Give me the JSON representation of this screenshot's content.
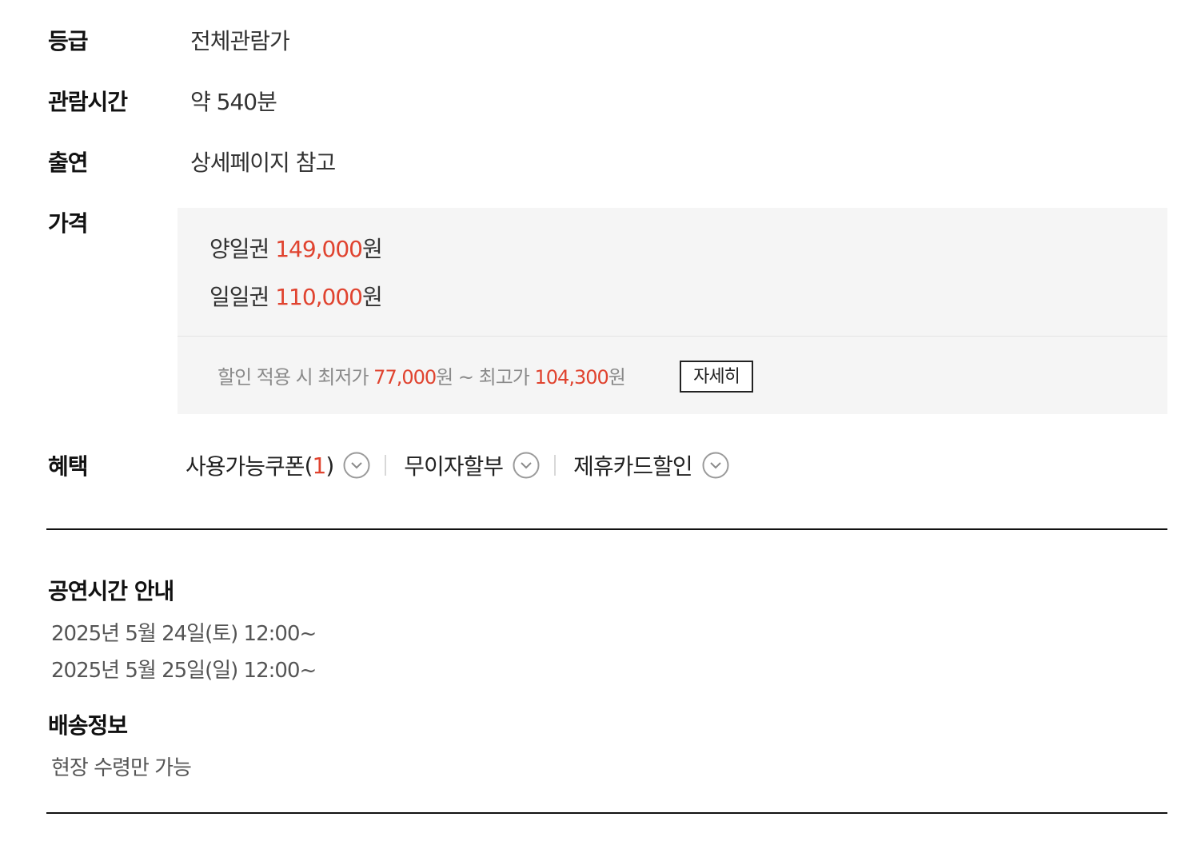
{
  "info": {
    "grade": {
      "label": "등급",
      "value": "전체관람가"
    },
    "runtime": {
      "label": "관람시간",
      "value": "약 540분"
    },
    "cast": {
      "label": "출연",
      "value": "상세페이지 참고"
    }
  },
  "price": {
    "label": "가격",
    "items": [
      {
        "name": "양일권",
        "amount": "149,000",
        "unit": "원"
      },
      {
        "name": "일일권",
        "amount": "110,000",
        "unit": "원"
      }
    ],
    "discount": {
      "prefix": "할인 적용 시 최저가",
      "min_amount": "77,000",
      "min_unit": "원",
      "separator": "~ 최고가",
      "max_amount": "104,300",
      "max_unit": "원",
      "detail_button": "자세히"
    },
    "accent_color": "#e0432f"
  },
  "benefits": {
    "label": "혜택",
    "items": [
      {
        "text": "사용가능쿠폰",
        "open_paren": "(",
        "count": "1",
        "close_paren": ")",
        "icon": "chevron-down-circle-icon"
      },
      {
        "text": "무이자할부",
        "icon": "chevron-down-circle-icon"
      },
      {
        "text": "제휴카드할인",
        "icon": "chevron-down-circle-icon"
      }
    ]
  },
  "schedule": {
    "title": "공연시간 안내",
    "lines": [
      "2025년 5월 24일(토) 12:00~",
      "2025년 5월 25일(일) 12:00~"
    ]
  },
  "delivery": {
    "title": "배송정보",
    "text": "현장 수령만 가능"
  }
}
